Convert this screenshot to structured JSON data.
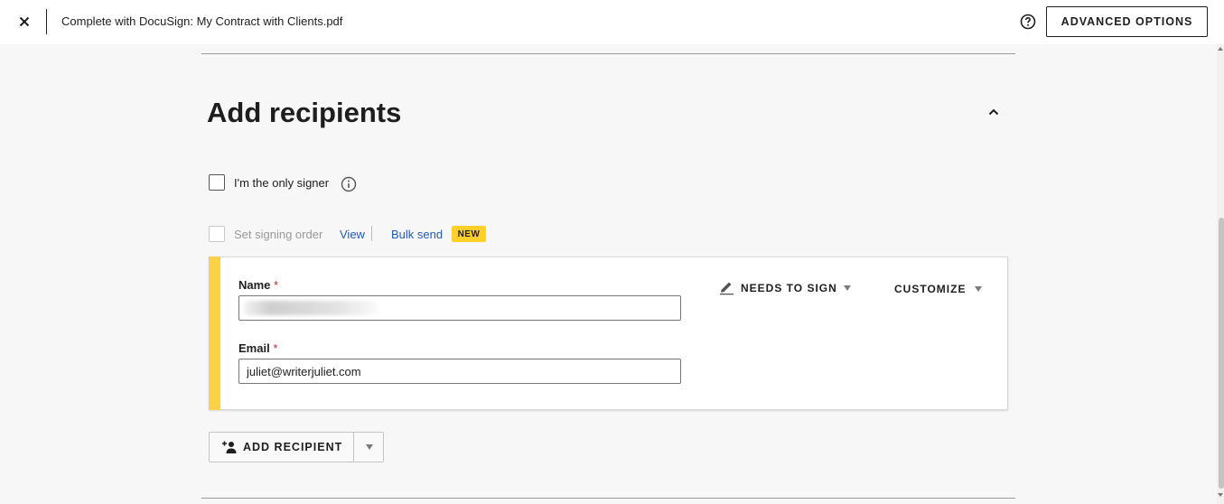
{
  "header": {
    "title": "Complete with DocuSign: My Contract with Clients.pdf",
    "advanced_options_label": "ADVANCED OPTIONS",
    "close_icon": "close-icon",
    "help_icon": "question-circle-icon"
  },
  "section": {
    "title": "Add recipients",
    "collapse_icon": "chevron-up-icon"
  },
  "options": {
    "only_signer_label": "I'm the only signer",
    "only_signer_checked": false,
    "signing_order_label": "Set signing order",
    "signing_order_enabled": false,
    "view_link": "View",
    "bulk_send_link": "Bulk send",
    "new_badge": "NEW"
  },
  "recipient": {
    "name_label": "Name",
    "name_value": "",
    "email_label": "Email",
    "email_value": "juliet@writerjuliet.com",
    "required_mark": "*",
    "role_label": "NEEDS TO SIGN",
    "role_icon": "pen-icon",
    "customize_label": "CUSTOMIZE",
    "accent_color": "#f9d24a"
  },
  "actions": {
    "add_recipient_label": "ADD RECIPIENT",
    "add_recipient_icon": "add-person-icon"
  },
  "colors": {
    "background": "#f7f7f7",
    "link": "#1e5bbf",
    "badge": "#ffd02a",
    "required": "#c0272d"
  }
}
